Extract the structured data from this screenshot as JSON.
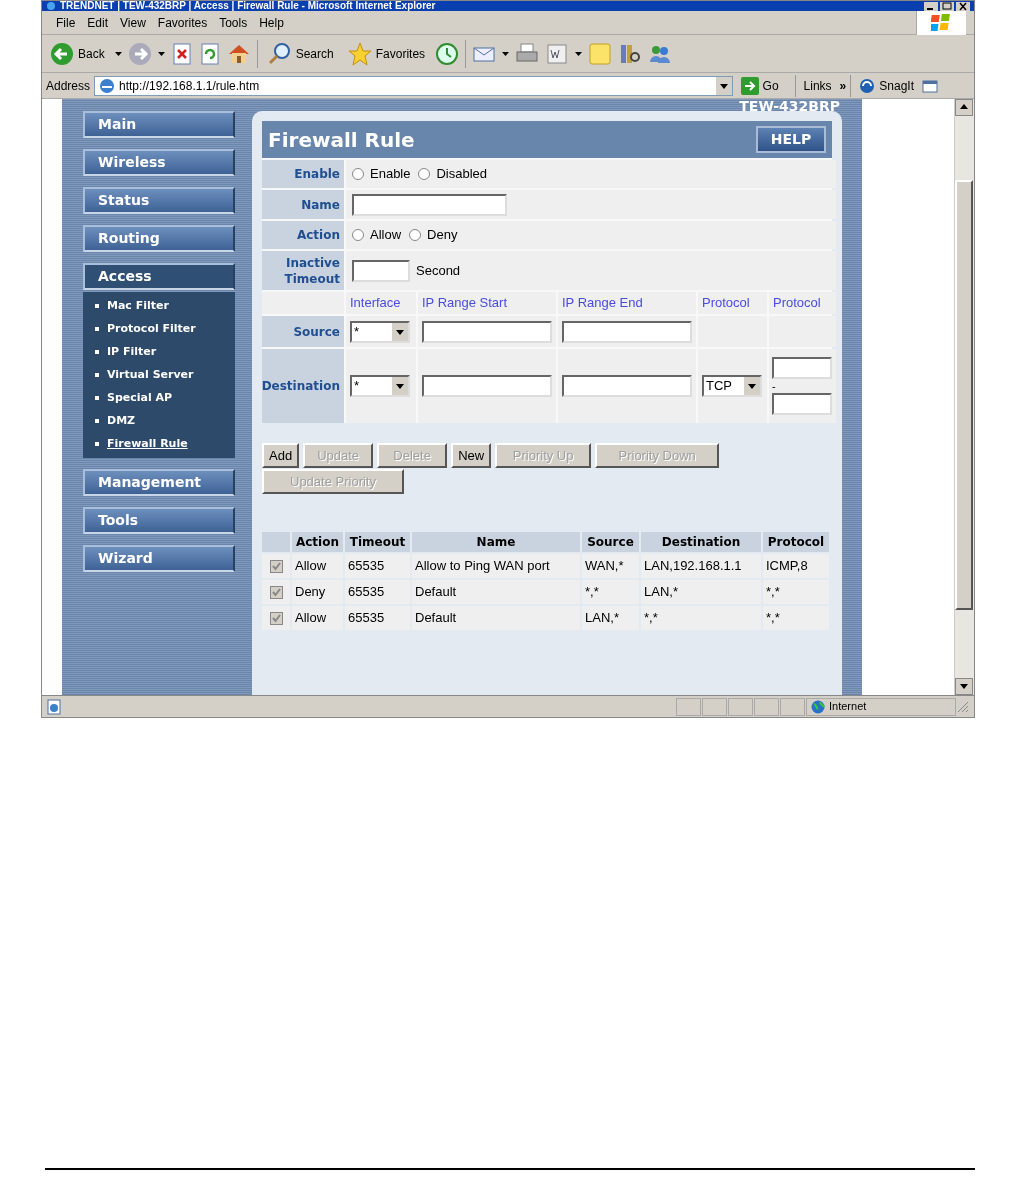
{
  "window": {
    "title": "TRENDNET | TEW-432BRP | Access | Firewall Rule - Microsoft Internet Explorer"
  },
  "menu_bar": [
    "File",
    "Edit",
    "View",
    "Favorites",
    "Tools",
    "Help"
  ],
  "toolbar": {
    "back": "Back",
    "search": "Search",
    "favorites": "Favorites"
  },
  "address_bar": {
    "label": "Address",
    "url": "http://192.168.1.1/rule.htm",
    "go": "Go",
    "links": "Links",
    "chevron": "»",
    "snagit": "SnagIt"
  },
  "page": {
    "model": "TEW-432BRP",
    "nav": [
      {
        "label": "Main",
        "expanded": false
      },
      {
        "label": "Wireless",
        "expanded": false
      },
      {
        "label": "Status",
        "expanded": false
      },
      {
        "label": "Routing",
        "expanded": false
      },
      {
        "label": "Access",
        "expanded": true,
        "children": [
          {
            "label": "Mac Filter",
            "selected": false
          },
          {
            "label": "Protocol Filter",
            "selected": false
          },
          {
            "label": "IP Filter",
            "selected": false
          },
          {
            "label": "Virtual Server",
            "selected": false
          },
          {
            "label": "Special AP",
            "selected": false
          },
          {
            "label": "DMZ",
            "selected": false
          },
          {
            "label": "Firewall Rule",
            "selected": true
          }
        ]
      },
      {
        "label": "Management",
        "expanded": false
      },
      {
        "label": "Tools",
        "expanded": false
      },
      {
        "label": "Wizard",
        "expanded": false
      }
    ],
    "panel": {
      "title": "Firewall Rule",
      "help": "HELP",
      "enable": {
        "label": "Enable",
        "options": [
          {
            "label": "Enable",
            "selected": false
          },
          {
            "label": "Disabled",
            "selected": false
          }
        ]
      },
      "name": {
        "label": "Name"
      },
      "action": {
        "label": "Action",
        "options": [
          {
            "label": "Allow",
            "selected": false
          },
          {
            "label": "Deny",
            "selected": false
          }
        ]
      },
      "timeout": {
        "label": "Inactive Timeout",
        "unit": "Second"
      },
      "columns": [
        "Interface",
        "IP Range Start",
        "IP Range End",
        "Protocol",
        "Protocol"
      ],
      "source": {
        "label": "Source",
        "interface": "*"
      },
      "destination": {
        "label": "Destination",
        "interface": "*",
        "protocol": "TCP",
        "port_separator": "-"
      },
      "buttons": [
        {
          "label": "Add",
          "disabled": false
        },
        {
          "label": "Update",
          "disabled": true
        },
        {
          "label": "Delete",
          "disabled": true
        },
        {
          "label": "New",
          "disabled": false
        },
        {
          "label": "Priority Up",
          "disabled": true
        },
        {
          "label": "Priority Down",
          "disabled": true
        },
        {
          "label": "Update Priority",
          "disabled": true
        }
      ],
      "rules": {
        "columns": [
          "Action",
          "Timeout",
          "Name",
          "Source",
          "Destination",
          "Protocol"
        ],
        "rows": [
          {
            "checked": true,
            "disabled": true,
            "cells": [
              "Allow",
              "65535",
              "Allow to Ping WAN port",
              "WAN,*",
              "LAN,192.168.1.1",
              "ICMP,8"
            ]
          },
          {
            "checked": true,
            "disabled": true,
            "cells": [
              "Deny",
              "65535",
              "Default",
              "*,*",
              "LAN,*",
              "*,*"
            ]
          },
          {
            "checked": true,
            "disabled": true,
            "cells": [
              "Allow",
              "65535",
              "Default",
              "LAN,*",
              "*,*",
              "*,*"
            ]
          }
        ]
      }
    }
  },
  "status_bar": {
    "zone": "Internet"
  }
}
